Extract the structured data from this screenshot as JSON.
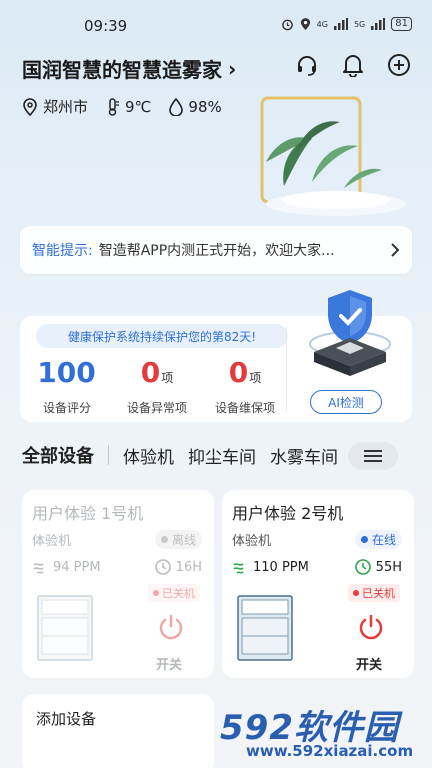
{
  "status_bar": {
    "time": "09:39",
    "signal_a": "4G",
    "signal_b": "5G",
    "battery": "81"
  },
  "header": {
    "title": "国润智慧的智慧造雾家",
    "chevron": "›"
  },
  "weather": {
    "city": "郑州市",
    "temperature": "9℃",
    "humidity": "98%"
  },
  "notice": {
    "label": "智能提示:",
    "text": "智造帮APP内测正式开始，欢迎大家..."
  },
  "health": {
    "banner": "健康保护系统持续保护您的第82天!",
    "stats": [
      {
        "value": "100",
        "unit": "",
        "caption": "设备评分",
        "color": "#2f6fd6"
      },
      {
        "value": "0",
        "unit": "项",
        "caption": "设备异常项",
        "color": "#e23c3c"
      },
      {
        "value": "0",
        "unit": "项",
        "caption": "设备维保项",
        "color": "#e23c3c"
      }
    ],
    "ai_button": "AI检测"
  },
  "tabs": {
    "active": "全部设备",
    "items": [
      "体验机",
      "抑尘车间",
      "水雾车间",
      "…"
    ]
  },
  "devices": [
    {
      "name": "用户体验 1号机",
      "type": "体验机",
      "status": "离线",
      "ppm": "94 PPM",
      "hours": "16H",
      "power_state": "已关机",
      "power_label": "开关"
    },
    {
      "name": "用户体验 2号机",
      "type": "体验机",
      "status": "在线",
      "ppm": "110 PPM",
      "hours": "55H",
      "power_state": "已关机",
      "power_label": "开关"
    }
  ],
  "add_device": "添加设备",
  "watermark": {
    "main": "592软件园",
    "url": "www.592xiazai.com"
  },
  "colors": {
    "accent": "#2f6fd6",
    "danger": "#e23c3c",
    "success": "#2ea44f"
  },
  "icons": [
    "headset-icon",
    "bell-icon",
    "plus-circle-icon",
    "location-icon",
    "thermometer-icon",
    "droplet-icon",
    "menu-icon",
    "power-icon",
    "fan-icon",
    "clock-icon"
  ]
}
